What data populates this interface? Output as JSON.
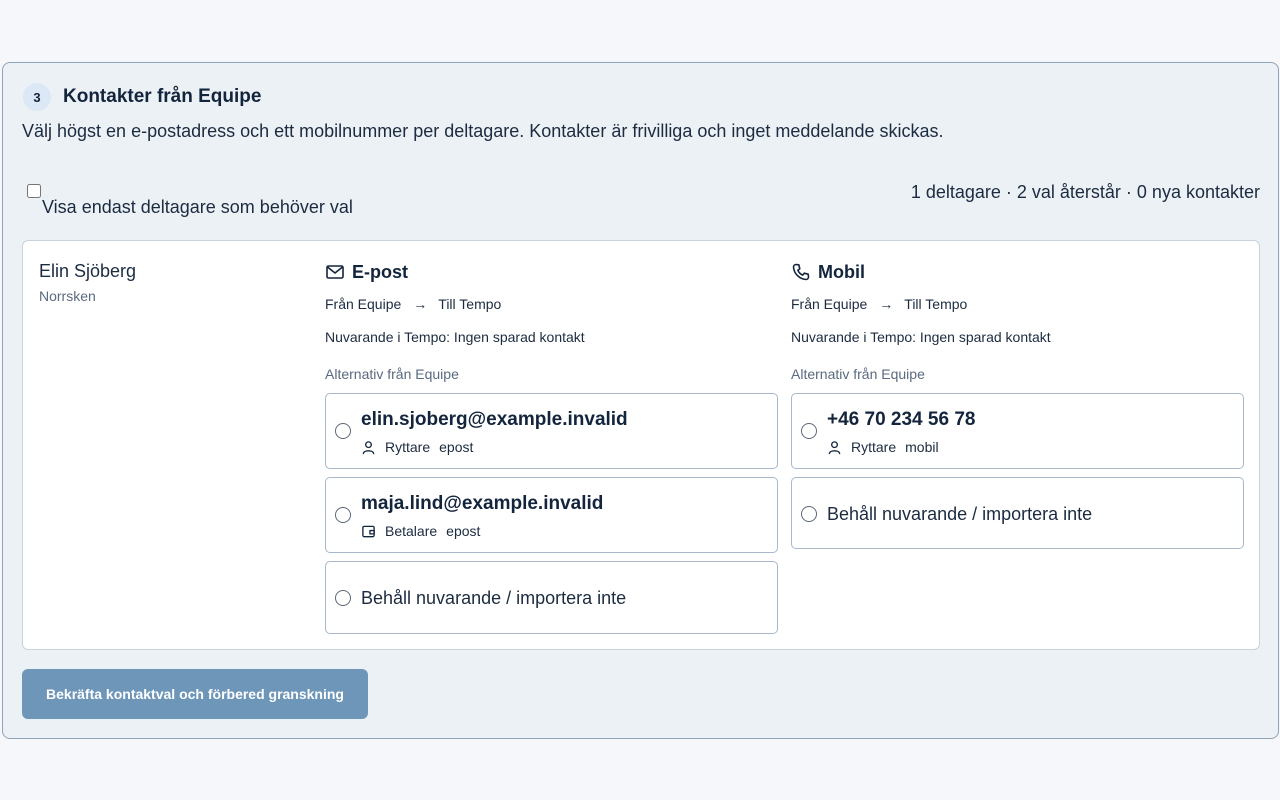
{
  "section": {
    "step": "3",
    "title": "Kontakter från Equipe",
    "description": "Välj högst en e-postadress och ett mobilnummer per deltagare. Kontakter är frivilliga och inget meddelande skickas."
  },
  "filter": {
    "label": "Visa endast deltagare som behöver val",
    "checked": false
  },
  "summary": "1 deltagare · 2 val återstår · 0 nya kontakter",
  "participant": {
    "name": "Elin Sjöberg",
    "team": "Norrsken"
  },
  "email": {
    "icon": "mail-icon",
    "title": "E-post",
    "from": "Från Equipe",
    "to": "Till Tempo",
    "current": "Nuvarande i Tempo: Ingen sparad kontakt",
    "alternatives_label": "Alternativ från Equipe",
    "options": [
      {
        "value": "elin.sjoberg@example.invalid",
        "role_icon": "person-icon",
        "role": "Ryttare",
        "type": "epost"
      },
      {
        "value": "maja.lind@example.invalid",
        "role_icon": "wallet-icon",
        "role": "Betalare",
        "type": "epost"
      }
    ],
    "keep_label": "Behåll nuvarande / importera inte"
  },
  "mobile": {
    "icon": "phone-icon",
    "title": "Mobil",
    "from": "Från Equipe",
    "to": "Till Tempo",
    "current": "Nuvarande i Tempo: Ingen sparad kontakt",
    "alternatives_label": "Alternativ från Equipe",
    "options": [
      {
        "value": "+46 70 234 56 78",
        "role_icon": "person-icon",
        "role": "Ryttare",
        "type": "mobil"
      }
    ],
    "keep_label": "Behåll nuvarande / importera inte"
  },
  "confirm_button": "Bekräfta kontaktval och förbered granskning",
  "colors": {
    "panel_bg": "#ecf1f6",
    "card_bg": "#ffffff",
    "button_bg": "#6e96b9",
    "text": "#13243d"
  }
}
